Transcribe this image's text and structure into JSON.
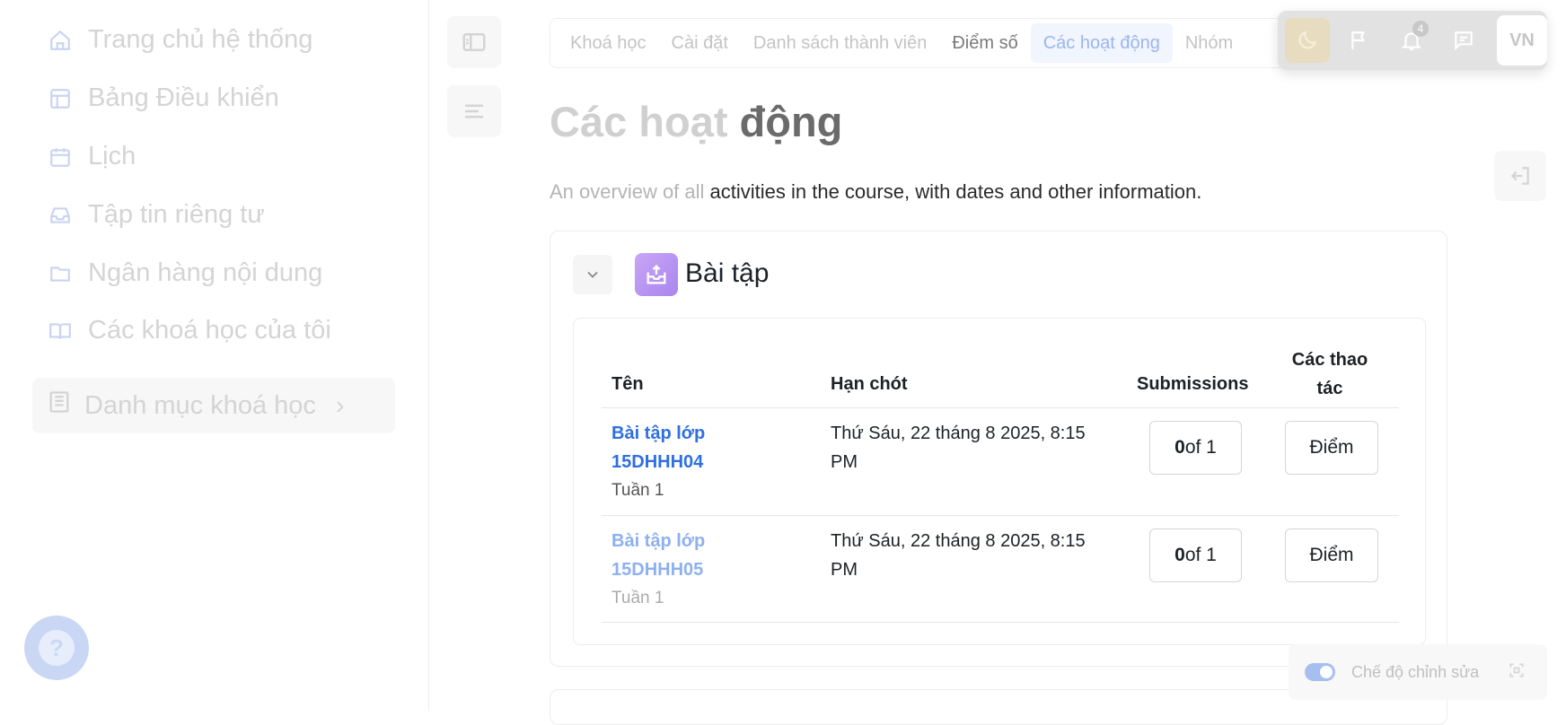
{
  "sidebar": {
    "items": [
      {
        "label": "Trang chủ hệ thống",
        "icon": "home-icon"
      },
      {
        "label": "Bảng Điều khiển",
        "icon": "dashboard-icon"
      },
      {
        "label": "Lịch",
        "icon": "calendar-icon"
      },
      {
        "label": "Tập tin riêng tư",
        "icon": "inbox-icon"
      },
      {
        "label": "Ngân hàng nội dung",
        "icon": "folder-icon"
      },
      {
        "label": "Các khoá học của tôi",
        "icon": "book-open-icon"
      }
    ],
    "category": {
      "label": "Danh mục khoá học",
      "icon": "book-icon"
    },
    "help_label": "?"
  },
  "tabs": [
    {
      "label": "Khoá học"
    },
    {
      "label": "Cài đặt"
    },
    {
      "label": "Danh sách thành viên"
    },
    {
      "label": "Điểm số"
    },
    {
      "label": "Các hoạt động"
    },
    {
      "label": "Nhóm"
    }
  ],
  "topbar": {
    "notification_count": "4",
    "avatar_initials": "VN"
  },
  "page": {
    "title_part1": "Các hoạt ",
    "title_part2": "động",
    "desc_part1": "An overview of all ",
    "desc_part2": "activities in the course, with dates and other information."
  },
  "section": {
    "title": "Bài tập",
    "columns": {
      "name": "Tên",
      "due": "Hạn chót",
      "submissions": "Submissions",
      "actions_line1": "Các thao",
      "actions_line2": "tác"
    },
    "rows": [
      {
        "name_line1": "Bài tập lớp",
        "name_line2": "15DHHH04",
        "week": "Tuần 1",
        "due_line1": "Thứ Sáu, 22 tháng 8 2025, 8:15",
        "due_line2": "PM",
        "sub_count": "0",
        "sub_rest": "of 1",
        "action": "Điểm"
      },
      {
        "name_line1": "Bài tập lớp",
        "name_line2": "15DHHH05",
        "week": "Tuần 1",
        "due_line1": "Thứ Sáu, 22 tháng 8 2025, 8:15",
        "due_line2": "PM",
        "sub_count": "0",
        "sub_rest": "of 1",
        "action": "Điểm"
      }
    ]
  },
  "edit_mode": {
    "label": "Chế độ chỉnh sửa",
    "enabled": true
  },
  "colors": {
    "link": "#2f6fe0",
    "active_tab": "#9bb6ee",
    "section_icon": "#b596f2"
  }
}
